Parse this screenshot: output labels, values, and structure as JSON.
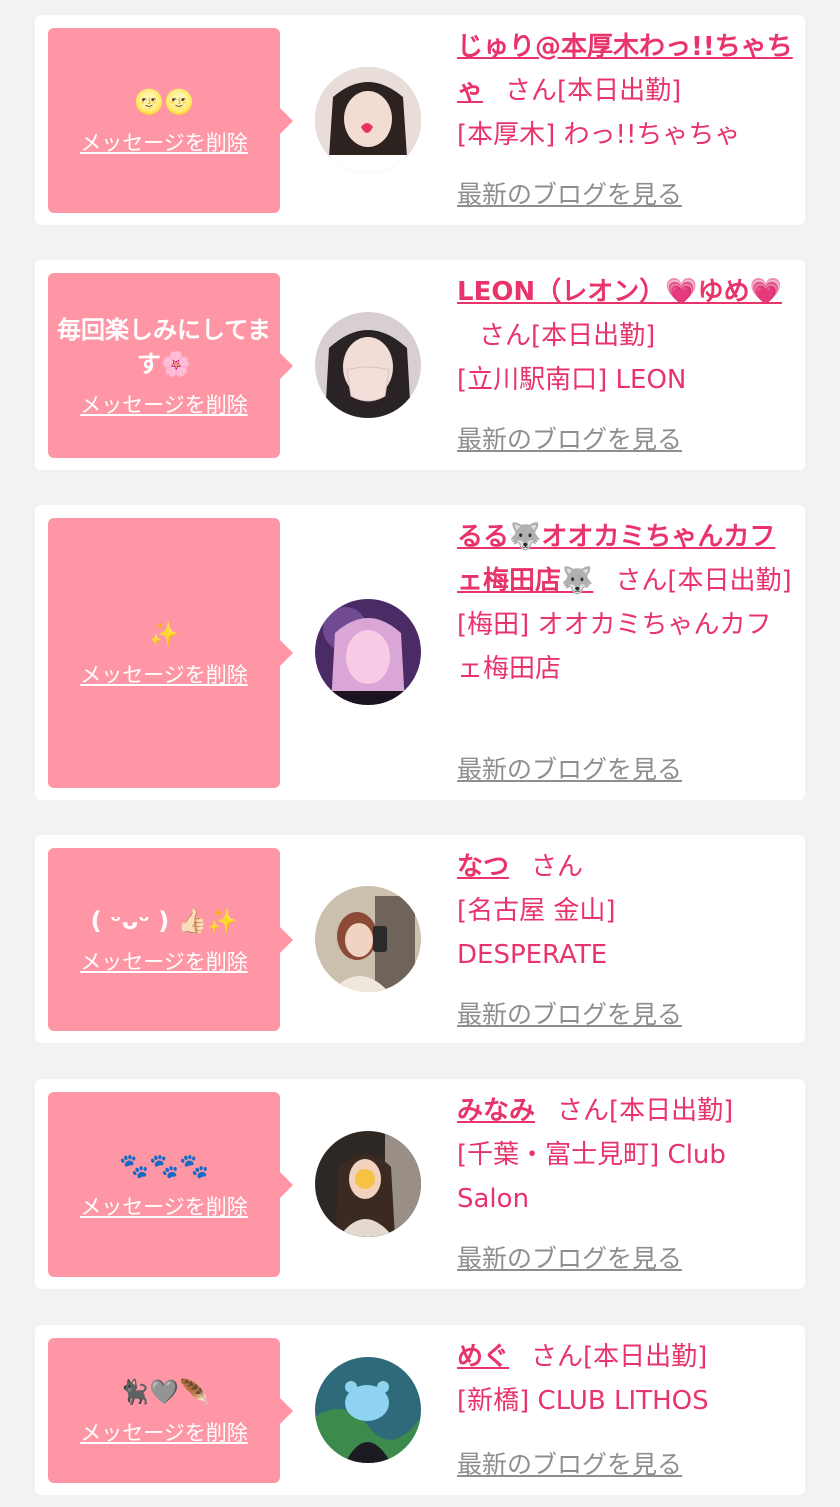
{
  "common": {
    "delete_label": "メッセージを削除",
    "blog_label": "最新のブログを見る",
    "san": "さん"
  },
  "cards": [
    {
      "message": "🌝🌝",
      "name": "じゅり@本厚木わっ!!ちゃちゃ",
      "status": "[本日出勤]",
      "shop": "[本厚木] わっ!!ちゃちゃ"
    },
    {
      "message": "毎回楽しみにしてます🌸",
      "name": "LEON（レオン）💗ゆめ💗",
      "status": "[本日出勤]",
      "shop": "[立川駅南口] LEON"
    },
    {
      "message": "✨",
      "name": "るる🐺オオカミちゃんカフェ梅田店🐺",
      "status": "[本日出勤]",
      "shop": "[梅田] オオカミちゃんカフェ梅田店"
    },
    {
      "message": "( ᵕᴗᵕ ) 👍🏻✨",
      "name": "なつ",
      "status": "",
      "shop": "[名古屋 金山] DESPERATE"
    },
    {
      "message": "🐾🐾🐾",
      "name": "みなみ",
      "status": "[本日出勤]",
      "shop": "[千葉・富士見町] Club Salon"
    },
    {
      "message": "🐈‍⬛🩶🪶",
      "name": "めぐ",
      "status": "[本日出勤]",
      "shop": "[新橋] CLUB LITHOS"
    }
  ],
  "colors": {
    "page_bg": "#f2f2f2",
    "bubble": "#ff96a5",
    "accent": "#e8336b",
    "link_gray": "#8e8e8e"
  }
}
